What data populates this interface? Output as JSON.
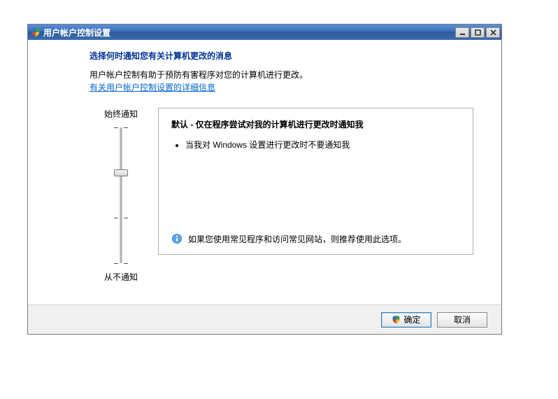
{
  "window": {
    "title": "用户帐户控制设置"
  },
  "content": {
    "heading": "选择何时通知您有关计算机更改的消息",
    "desc": "用户帐户控制有助于预防有害程序对您的计算机进行更改。",
    "link": "有关用户帐户控制设置的详细信息"
  },
  "slider": {
    "top_label": "始终通知",
    "bottom_label": "从不通知",
    "levels": 4,
    "current": 2
  },
  "info": {
    "title": "默认 - 仅在程序尝试对我的计算机进行更改时通知我",
    "bullets": [
      "当我对 Windows 设置进行更改时不要通知我"
    ],
    "recommend": "如果您使用常见程序和访问常见网站，则推荐使用此选项。"
  },
  "buttons": {
    "ok": "确定",
    "cancel": "取消"
  }
}
